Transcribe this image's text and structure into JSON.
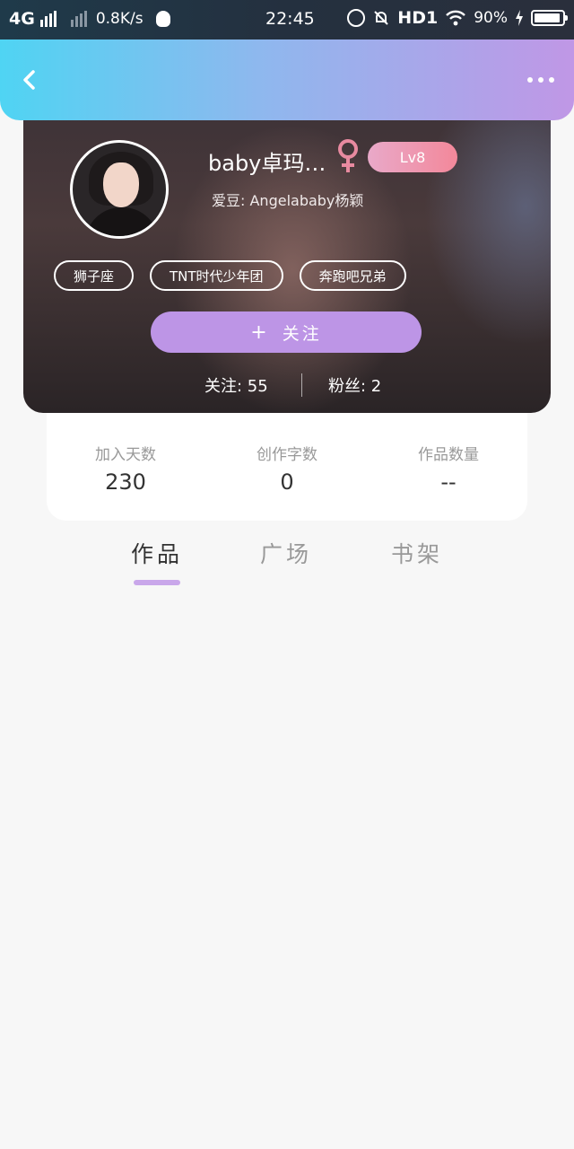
{
  "status_bar": {
    "network": "4G",
    "speed": "0.8K/s",
    "time": "22:45",
    "hd": "HD1",
    "battery": "90%",
    "icons": [
      "signal-icon",
      "qq-icon",
      "alarm-icon",
      "mute-bell-icon",
      "wifi-icon",
      "charging-icon",
      "battery-icon"
    ]
  },
  "header": {
    "back_icon": "chevron-left-icon",
    "more_icon": "more-dots-icon",
    "gradient_from": "#4fd4f3",
    "gradient_to": "#c097e6"
  },
  "profile": {
    "name": "baby卓玛…",
    "gender_icon": "female-icon",
    "level": "Lv8",
    "idol": "爱豆: Angelababy杨颖",
    "tags": [
      "狮子座",
      "TNT时代少年团",
      "奔跑吧兄弟"
    ],
    "follow_button": "关注",
    "follow_count": "关注: 55",
    "fans_count": "粉丝: 2"
  },
  "stats": [
    {
      "label": "加入天数",
      "value": "230"
    },
    {
      "label": "创作字数",
      "value": "0"
    },
    {
      "label": "作品数量",
      "value": "--"
    }
  ],
  "tabs": {
    "items": [
      "作品",
      "广场",
      "书架"
    ],
    "active": "作品",
    "accent": "#c9a7ea"
  }
}
